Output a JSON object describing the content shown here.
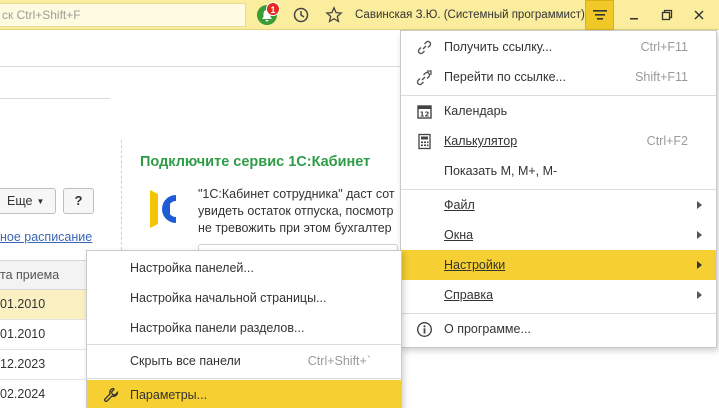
{
  "topbar": {
    "search_placeholder": "ск Ctrl+Shift+F",
    "notification_count": "1",
    "username": "Савинская З.Ю. (Системный программист)"
  },
  "content": {
    "more_label": "Еще",
    "help_label": "?",
    "schedule_link": "ное расписание",
    "promo_title": "Подключите сервис 1С:Кабинет",
    "promo_lines": [
      "\"1С:Кабинет сотрудника\" даст сот",
      "увидеть остаток отпуска, посмотр",
      "не тревожить при этом бухгалтер"
    ],
    "table": {
      "header": "та приема",
      "rows": [
        "01.2010",
        "01.2010",
        "12.2023",
        "02.2024"
      ]
    },
    "brand_colors": {
      "accent": "#f6cf32",
      "promo_green": "#2f9c47",
      "link_blue": "#3a66b5"
    }
  },
  "main_menu": {
    "items": [
      {
        "icon": "link-icon",
        "label": "Получить ссылку...",
        "shortcut": "Ctrl+F11"
      },
      {
        "icon": "goto-link-icon",
        "label": "Перейти по ссылке...",
        "shortcut": "Shift+F11"
      },
      {
        "icon": "calendar-icon",
        "label": "Календарь",
        "shortcut": ""
      },
      {
        "icon": "calculator-icon",
        "label": "Калькулятор",
        "shortcut": "Ctrl+F2"
      },
      {
        "icon": "",
        "label": "Показать M, M+, M-",
        "shortcut": ""
      },
      {
        "icon": "",
        "label": "Файл",
        "shortcut": ""
      },
      {
        "icon": "",
        "label": "Окна",
        "shortcut": ""
      },
      {
        "icon": "",
        "label": "Настройки",
        "shortcut": ""
      },
      {
        "icon": "",
        "label": "Справка",
        "shortcut": ""
      },
      {
        "icon": "info-icon",
        "label": "О программе...",
        "shortcut": ""
      }
    ]
  },
  "settings_submenu": {
    "items": [
      {
        "label": "Настройка панелей...",
        "shortcut": ""
      },
      {
        "label": "Настройка начальной страницы...",
        "shortcut": ""
      },
      {
        "label": "Настройка панели разделов...",
        "shortcut": ""
      },
      {
        "label": "Скрыть все панели",
        "shortcut": "Ctrl+Shift+`"
      },
      {
        "icon": "wrench-icon",
        "label": "Параметры...",
        "shortcut": ""
      }
    ]
  }
}
